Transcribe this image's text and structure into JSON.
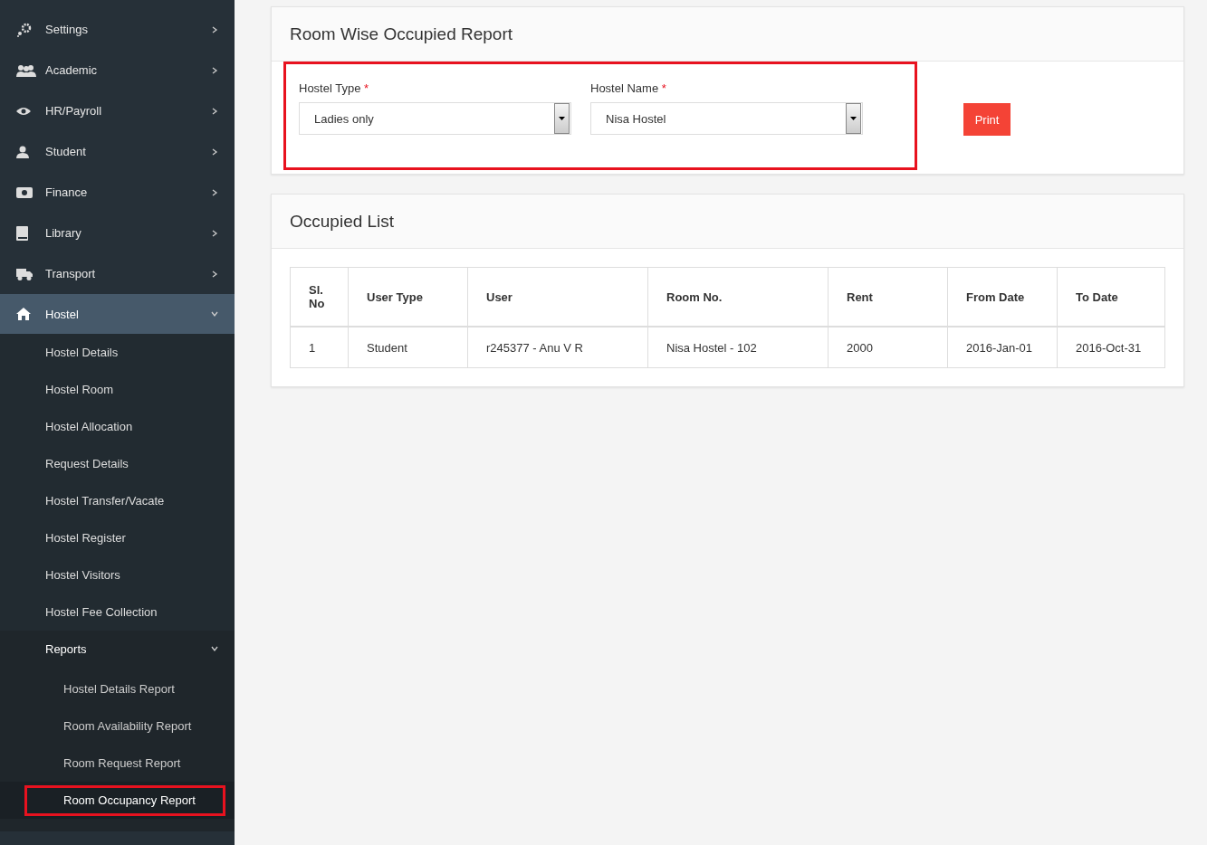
{
  "sidebar": {
    "items": [
      {
        "label": "Settings",
        "expanded": false,
        "selected": false
      },
      {
        "label": "Academic",
        "expanded": false,
        "selected": false
      },
      {
        "label": "HR/Payroll",
        "expanded": false,
        "selected": false
      },
      {
        "label": "Student",
        "expanded": false,
        "selected": false
      },
      {
        "label": "Finance",
        "expanded": false,
        "selected": false
      },
      {
        "label": "Library",
        "expanded": false,
        "selected": false
      },
      {
        "label": "Transport",
        "expanded": false,
        "selected": false
      },
      {
        "label": "Hostel",
        "expanded": true,
        "selected": true,
        "children": [
          {
            "label": "Hostel Details",
            "selected": false
          },
          {
            "label": "Hostel Room",
            "selected": false
          },
          {
            "label": "Hostel Allocation",
            "selected": false
          },
          {
            "label": "Request Details",
            "selected": false
          },
          {
            "label": "Hostel Transfer/Vacate",
            "selected": false
          },
          {
            "label": "Hostel Register",
            "selected": false
          },
          {
            "label": "Hostel Visitors",
            "selected": false
          },
          {
            "label": "Hostel Fee Collection",
            "selected": false
          },
          {
            "label": "Reports",
            "expanded": true,
            "selected": false,
            "children": [
              {
                "label": "Hostel Details Report",
                "selected": false,
                "highlighted": false
              },
              {
                "label": "Room Availability Report",
                "selected": false,
                "highlighted": false
              },
              {
                "label": "Room Request Report",
                "selected": false,
                "highlighted": false
              },
              {
                "label": "Room Occupancy Report",
                "selected": true,
                "highlighted": true
              }
            ]
          }
        ]
      }
    ]
  },
  "report_panel": {
    "title": "Room Wise Occupied Report",
    "highlighted": true,
    "fields": [
      {
        "label": "Hostel Type",
        "required_mark": "*",
        "value": "Ladies only"
      },
      {
        "label": "Hostel Name",
        "required_mark": "*",
        "value": "Nisa Hostel"
      }
    ],
    "print_button": "Print"
  },
  "occupied_list": {
    "title": "Occupied List",
    "table": {
      "columns": [
        "Sl. No",
        "User Type",
        "User",
        "Room No.",
        "Rent",
        "From Date",
        "To Date"
      ],
      "rows": [
        [
          "1",
          "Student",
          "r245377 - Anu V R",
          "Nisa Hostel - 102",
          "2000",
          "2016-Jan-01",
          "2016-Oct-31"
        ]
      ]
    }
  }
}
